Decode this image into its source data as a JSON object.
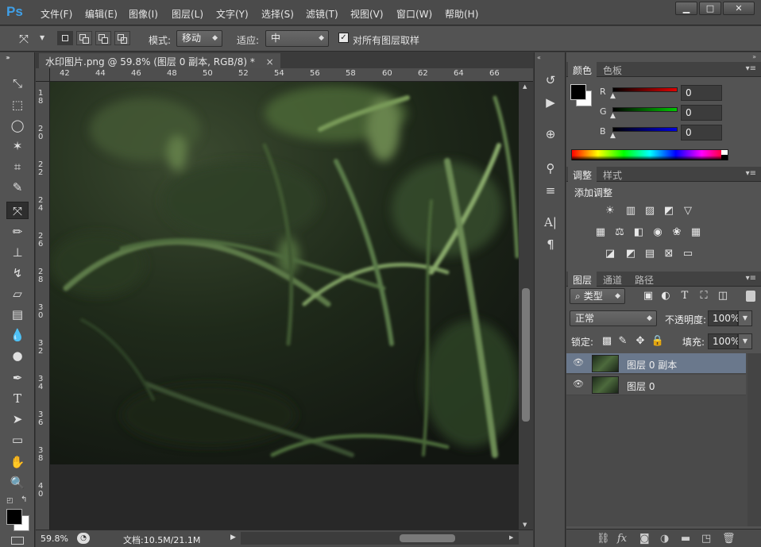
{
  "app": {
    "logo": "Ps"
  },
  "menu": [
    "文件(F)",
    "编辑(E)",
    "图像(I)",
    "图层(L)",
    "文字(Y)",
    "选择(S)",
    "滤镜(T)",
    "视图(V)",
    "窗口(W)",
    "帮助(H)"
  ],
  "window_controls": {
    "minimize": "▁",
    "maximize": "□",
    "close": "✕"
  },
  "options": {
    "mode_label": "模式:",
    "mode_value": "移动",
    "adapt_label": "适应:",
    "adapt_value": "中",
    "sample_all_label": "对所有图层取样",
    "sample_all_checked": true
  },
  "document": {
    "tab_title": "水印图片.png @ 59.8% (图层 0 副本, RGB/8) *",
    "tab_close": "×",
    "h_ruler": [
      "42",
      "44",
      "46",
      "48",
      "50",
      "52",
      "54",
      "56",
      "58",
      "60",
      "62",
      "64",
      "66"
    ],
    "v_ruler": [
      "1\n8",
      "2\n0",
      "2\n2",
      "2\n4",
      "2\n6",
      "2\n8",
      "3\n0",
      "3\n2",
      "3\n4",
      "3\n6",
      "3\n8",
      "4\n0"
    ],
    "zoom": "59.8%",
    "doc_size": "文档:10.5M/21.1M"
  },
  "color_panel": {
    "tabs": [
      "颜色",
      "色板"
    ],
    "channels": [
      {
        "label": "R",
        "value": "0",
        "color": "#e00000"
      },
      {
        "label": "G",
        "value": "0",
        "color": "#00c800"
      },
      {
        "label": "B",
        "value": "0",
        "color": "#0000e0"
      }
    ],
    "foreground": "#000000",
    "background": "#ffffff"
  },
  "adjust_panel": {
    "tabs": [
      "调整",
      "样式"
    ],
    "title": "添加调整"
  },
  "layers_panel": {
    "tabs": [
      "图层",
      "通道",
      "路径"
    ],
    "filter_value": "类型",
    "blend_mode": "正常",
    "opacity_label": "不透明度:",
    "opacity_value": "100%",
    "lock_label": "锁定:",
    "fill_label": "填充:",
    "fill_value": "100%",
    "layers": [
      {
        "name": "图层 0 副本",
        "selected": true
      },
      {
        "name": "图层 0",
        "selected": false
      }
    ]
  }
}
